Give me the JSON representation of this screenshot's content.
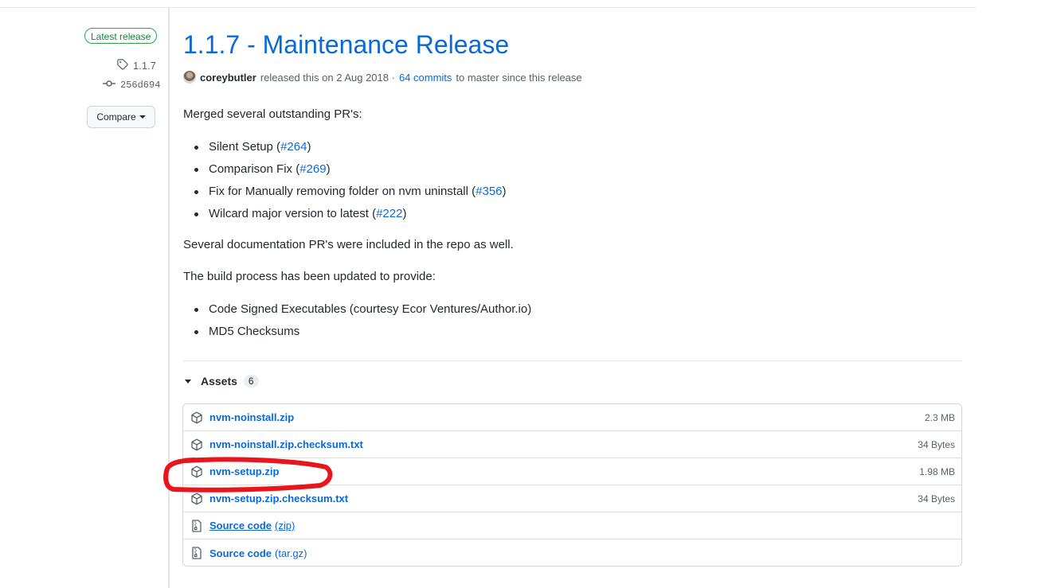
{
  "sidebar": {
    "badge": "Latest release",
    "tag": "1.1.7",
    "commit": "256d694",
    "compare_label": "Compare"
  },
  "release": {
    "title": "1.1.7 - Maintenance Release",
    "author": "coreybutler",
    "released_text": "released this on 2 Aug 2018 ·",
    "commits_link": "64 commits",
    "since_text": "to master since this release"
  },
  "notes": {
    "intro": "Merged several outstanding PR's:",
    "prs": [
      {
        "text": "Silent Setup (",
        "link": "#264",
        "tail": ")"
      },
      {
        "text": "Comparison Fix (",
        "link": "#269",
        "tail": ")"
      },
      {
        "text": "Fix for Manually removing folder on nvm uninstall (",
        "link": "#356",
        "tail": ")"
      },
      {
        "text": "Wilcard major version to latest (",
        "link": "#222",
        "tail": ")"
      }
    ],
    "docs": "Several documentation PR's were included in the repo as well.",
    "build_intro": "The build process has been updated to provide:",
    "build_items": [
      "Code Signed Executables (courtesy Ecor Ventures/Author.io)",
      "MD5 Checksums"
    ]
  },
  "assets": {
    "label": "Assets",
    "count": "6",
    "files": [
      {
        "name": "nvm-noinstall.zip",
        "size": "2.3 MB"
      },
      {
        "name": "nvm-noinstall.zip.checksum.txt",
        "size": "34 Bytes"
      },
      {
        "name": "nvm-setup.zip",
        "size": "1.98 MB"
      },
      {
        "name": "nvm-setup.zip.checksum.txt",
        "size": "34 Bytes"
      }
    ],
    "source": [
      {
        "name": "Source code",
        "ext": "(zip)"
      },
      {
        "name": "Source code",
        "ext": "(tar.gz)"
      }
    ]
  },
  "colors": {
    "link": "#0969da",
    "annotation": "#e8161c",
    "badge_green": "#1a7f37"
  },
  "icons": [
    "tag-icon",
    "commit-icon",
    "package-icon",
    "file-zip-icon",
    "caret-down-icon",
    "triangle-down-icon"
  ]
}
